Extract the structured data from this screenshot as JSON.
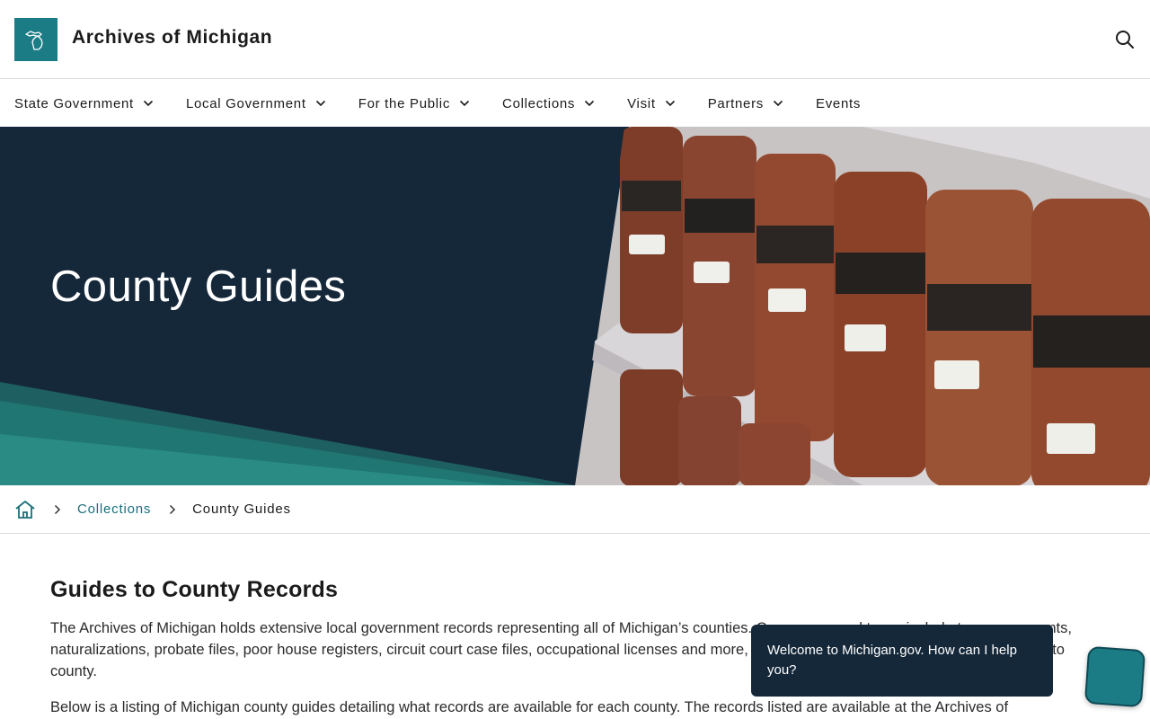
{
  "header": {
    "site_title": "Archives of Michigan",
    "logo_icon": "michigan-map-icon",
    "search_icon": "search-icon",
    "brand_color": "#1c7c86"
  },
  "nav": {
    "items": [
      {
        "label": "State Government",
        "has_dropdown": true
      },
      {
        "label": "Local Government",
        "has_dropdown": true
      },
      {
        "label": "For the Public",
        "has_dropdown": true
      },
      {
        "label": "Collections",
        "has_dropdown": true
      },
      {
        "label": "Visit",
        "has_dropdown": true
      },
      {
        "label": "Partners",
        "has_dropdown": true
      },
      {
        "label": "Events",
        "has_dropdown": false
      }
    ]
  },
  "hero": {
    "title": "County Guides",
    "background_color": "#15283a",
    "accent_color": "#1f7a78"
  },
  "breadcrumb": {
    "home_icon": "home-icon",
    "items": [
      {
        "label": "Collections"
      },
      {
        "label": "County Guides"
      }
    ]
  },
  "main": {
    "heading": "Guides to County Records",
    "paragraphs": [
      "The Archives of Michigan holds extensive local government records representing all of Michigan’s counties. Common record types include tax assessments, naturalizations, probate files, poor house registers, circuit court case files, occupational licenses and more, though holdings may vary widely from county to county.",
      "Below is a listing of Michigan county guides detailing what records are available for each county. The records listed are available at the Archives of"
    ]
  },
  "chat": {
    "message": "Welcome to Michigan.gov. How can I help you?",
    "launcher_icon": "chat-launcher-icon"
  }
}
